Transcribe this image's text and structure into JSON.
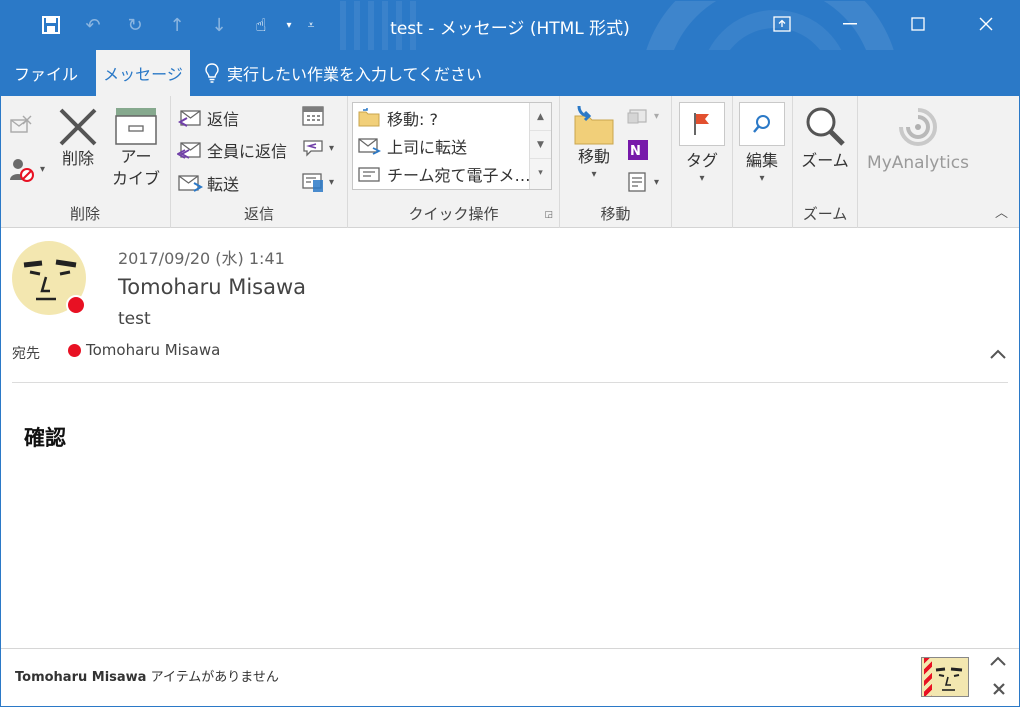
{
  "window": {
    "title": "test  -  メッセージ (HTML 形式)",
    "accent": "#2b79c7"
  },
  "qat": {
    "items": [
      "save-icon",
      "undo-icon",
      "redo-icon",
      "up-icon",
      "down-icon",
      "touch-icon"
    ]
  },
  "tabs": {
    "file": "ファイル",
    "message": "メッセージ",
    "tellme": "実行したい作業を入力してください"
  },
  "ribbon": {
    "delete_group": {
      "delete_label": "削除",
      "archive_label_1": "アー",
      "archive_label_2": "カイブ",
      "group_label": "削除"
    },
    "reply_group": {
      "reply": "返信",
      "reply_all": "全員に返信",
      "forward": "転送",
      "group_label": "返信"
    },
    "quick_steps": {
      "items": [
        "移動: ?",
        "上司に転送",
        "チーム宛て電子メ…"
      ],
      "group_label": "クイック操作"
    },
    "move_group": {
      "move_label": "移動",
      "group_label": "移動"
    },
    "tags_group": {
      "tag_label": "タグ"
    },
    "edit_group": {
      "edit_label": "編集"
    },
    "zoom_group": {
      "zoom_label": "ズーム",
      "group_label": "ズーム"
    },
    "analytics": {
      "label": "MyAnalytics"
    }
  },
  "message": {
    "date": "2017/09/20 (水) 1:41",
    "sender": "Tomoharu Misawa",
    "subject": "test",
    "to_label": "宛先",
    "to_name": "Tomoharu Misawa",
    "presence_color": "#e81123",
    "body": "確認"
  },
  "people_pane": {
    "name": "Tomoharu Misawa",
    "status": " アイテムがありません"
  }
}
